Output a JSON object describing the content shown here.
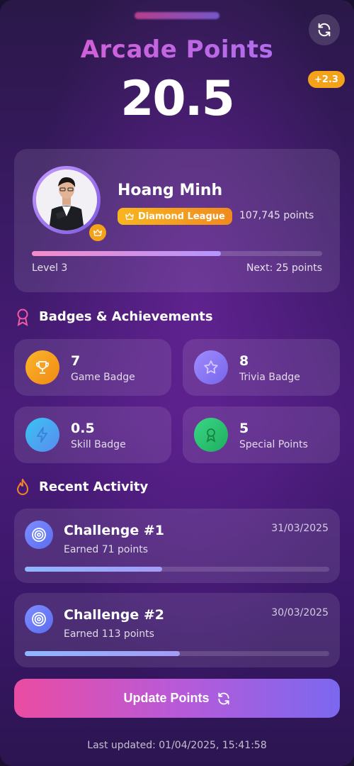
{
  "header": {
    "title": "Arcade Points",
    "score": "20.5",
    "delta": "+2.3",
    "refresh_icon": "refresh-icon"
  },
  "profile": {
    "name": "Hoang Minh",
    "league": "Diamond League",
    "points": "107,745 points",
    "level": "Level 3",
    "next": "Next: 25 points",
    "level_progress": 0.65
  },
  "badges": {
    "title": "Badges & Achievements",
    "items": [
      {
        "value": "7",
        "label": "Game Badge",
        "icon": "trophy-icon",
        "color": "#f7a01a"
      },
      {
        "value": "8",
        "label": "Trivia Badge",
        "icon": "star-icon",
        "color": "#8b7cf5"
      },
      {
        "value": "0.5",
        "label": "Skill Badge",
        "icon": "lightning-icon",
        "color": "#2fb6ea"
      },
      {
        "value": "5",
        "label": "Special Points",
        "icon": "ribbon-icon",
        "color": "#2ec774"
      }
    ]
  },
  "activity": {
    "title": "Recent Activity",
    "items": [
      {
        "title": "Challenge #1",
        "subtitle": "Earned 71 points",
        "date": "31/03/2025",
        "progress": 0.45
      },
      {
        "title": "Challenge #2",
        "subtitle": "Earned 113 points",
        "date": "30/03/2025",
        "progress": 0.51
      }
    ]
  },
  "footer": {
    "button_label": "Update Points",
    "last_updated": "Last updated: 01/04/2025, 15:41:58"
  },
  "colors": {
    "accent_pink": "#ea4ca2",
    "accent_purple": "#7b68ef",
    "gold": "#f5a21b"
  }
}
